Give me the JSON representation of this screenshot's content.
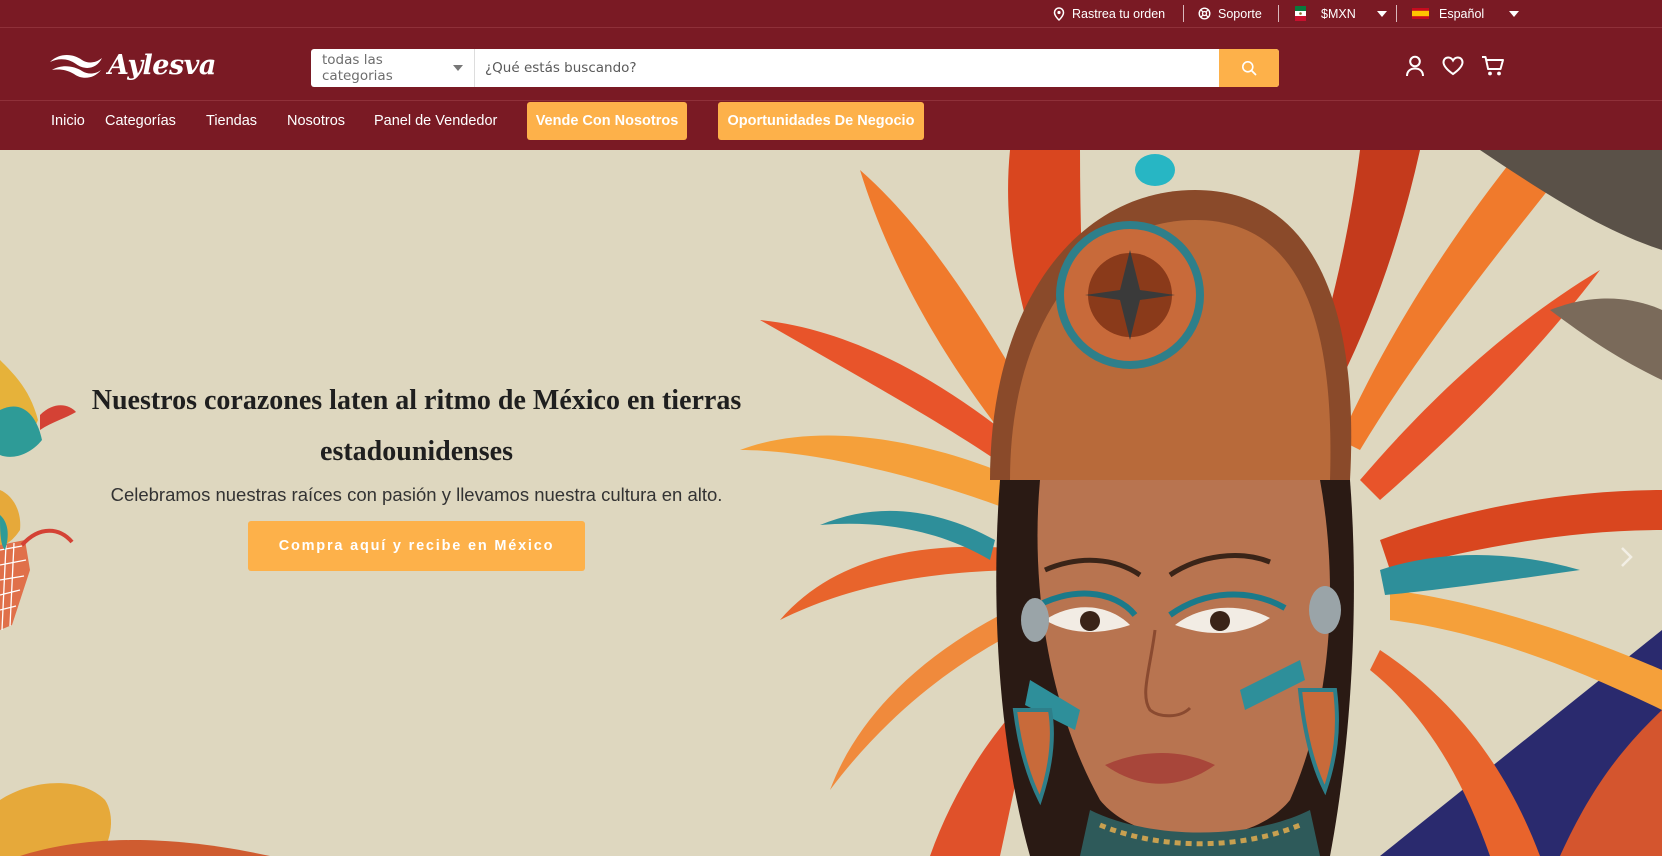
{
  "topbar": {
    "track_label": "Rastrea tu orden",
    "support_label": "Soporte",
    "currency_label": "$MXN",
    "language_label": "Español"
  },
  "header": {
    "logo_text": "Aylesva",
    "category_select": "todas las categorias",
    "search_placeholder": "¿Qué estás buscando?"
  },
  "nav": {
    "items": [
      "Inicio",
      "Categorías",
      "Tiendas",
      "Nosotros",
      "Panel de Vendedor"
    ],
    "cta_sell": "Vende Con Nosotros",
    "cta_business": "Oportunidades De Negocio"
  },
  "hero": {
    "title": "Nuestros corazones laten al ritmo de México en tierras estadounidenses",
    "subtitle": "Celebramos nuestras raíces con pasión y llevamos nuestra cultura en alto.",
    "button_label": "Compra aquí y recibe en México"
  },
  "colors": {
    "brand": "#7a1a24",
    "accent": "#fdb14a",
    "hero_background": "#ded7bf"
  }
}
